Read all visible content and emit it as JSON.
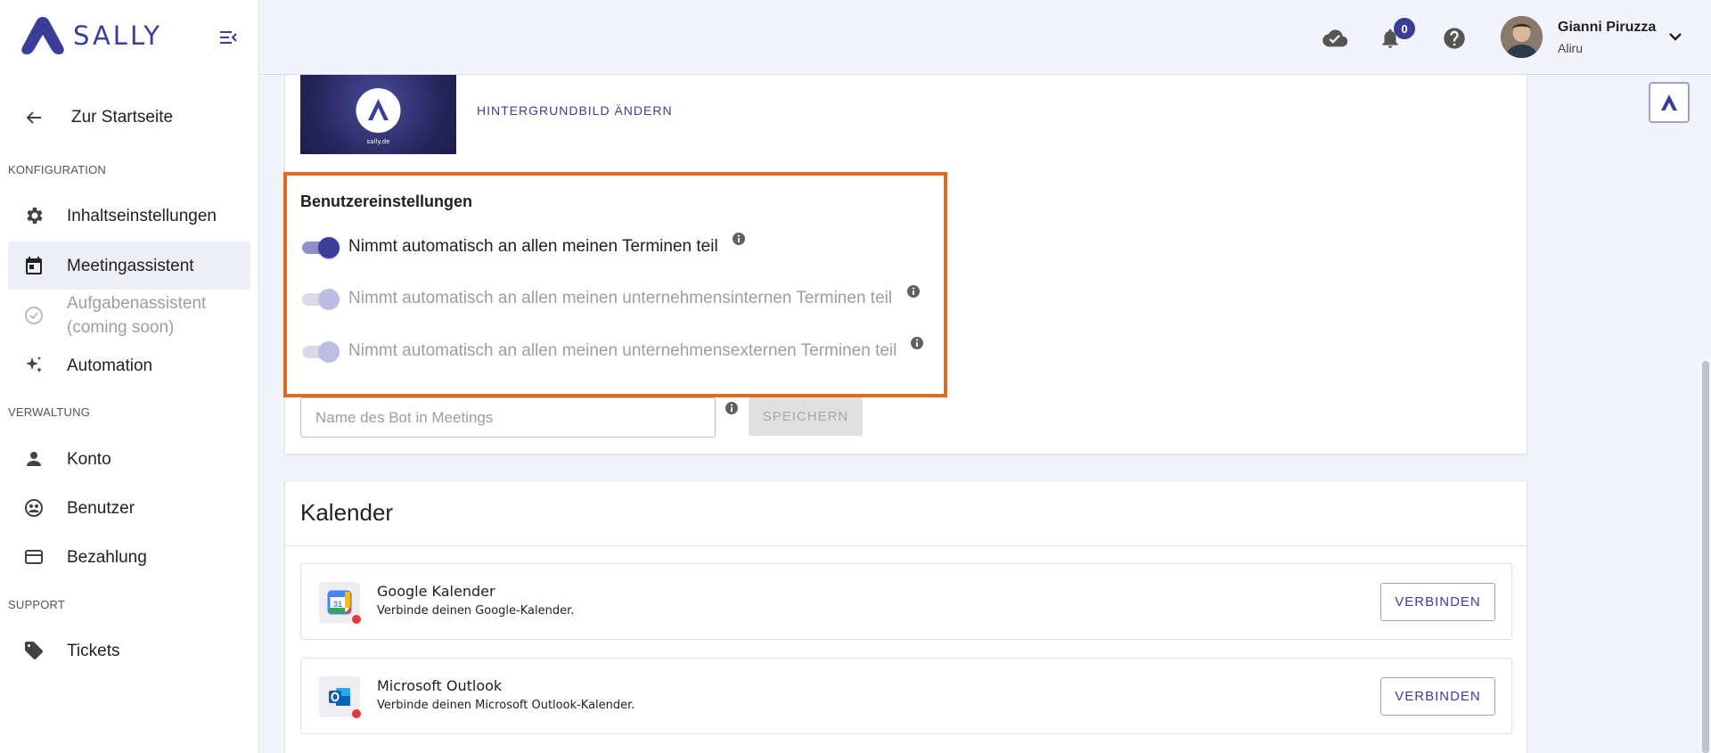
{
  "brand": {
    "name": "SALLY",
    "color": "#3b3e98"
  },
  "sidebar": {
    "back_label": "Zur Startseite",
    "sections": {
      "config": "KONFIGURATION",
      "admin": "VERWALTUNG",
      "support": "SUPPORT"
    },
    "items": [
      {
        "label": "Inhaltseinstellungen",
        "icon": "gear-icon"
      },
      {
        "label": "Meetingassistent",
        "icon": "calendar-icon",
        "active": true
      },
      {
        "label": "Aufgabenassistent\n(coming soon)",
        "icon": "check-circle-icon",
        "disabled": true
      },
      {
        "label": "Automation",
        "icon": "sparkle-icon"
      },
      {
        "label": "Konto",
        "icon": "person-icon"
      },
      {
        "label": "Benutzer",
        "icon": "users-icon"
      },
      {
        "label": "Bezahlung",
        "icon": "credit-card-icon"
      },
      {
        "label": "Tickets",
        "icon": "tag-icon"
      }
    ]
  },
  "topbar": {
    "notification_count": "0",
    "user_name": "Gianni Piruzza",
    "user_org": "Aliru"
  },
  "background": {
    "thumb_text": "sally.de",
    "change_label": "HINTERGRUNDBILD ÄNDERN"
  },
  "user_settings": {
    "title": "Benutzereinstellungen",
    "toggles": [
      {
        "label": "Nimmt automatisch an allen meinen Terminen teil",
        "enabled": true
      },
      {
        "label": "Nimmt automatisch an allen meinen unternehmensinternen Terminen teil",
        "enabled": false
      },
      {
        "label": "Nimmt automatisch an allen meinen unternehmensexternen Terminen teil",
        "enabled": false
      }
    ],
    "highlight_color": "#e06a23"
  },
  "bot_name": {
    "placeholder": "Name des Bot in Meetings",
    "value": "",
    "save_label": "SPEICHERN"
  },
  "calendar": {
    "title": "Kalender",
    "providers": [
      {
        "name": "Google Kalender",
        "description": "Verbinde deinen Google-Kalender.",
        "button": "VERBINDEN"
      },
      {
        "name": "Microsoft Outlook",
        "description": "Verbinde deinen Microsoft Outlook-Kalender.",
        "button": "VERBINDEN"
      }
    ]
  }
}
